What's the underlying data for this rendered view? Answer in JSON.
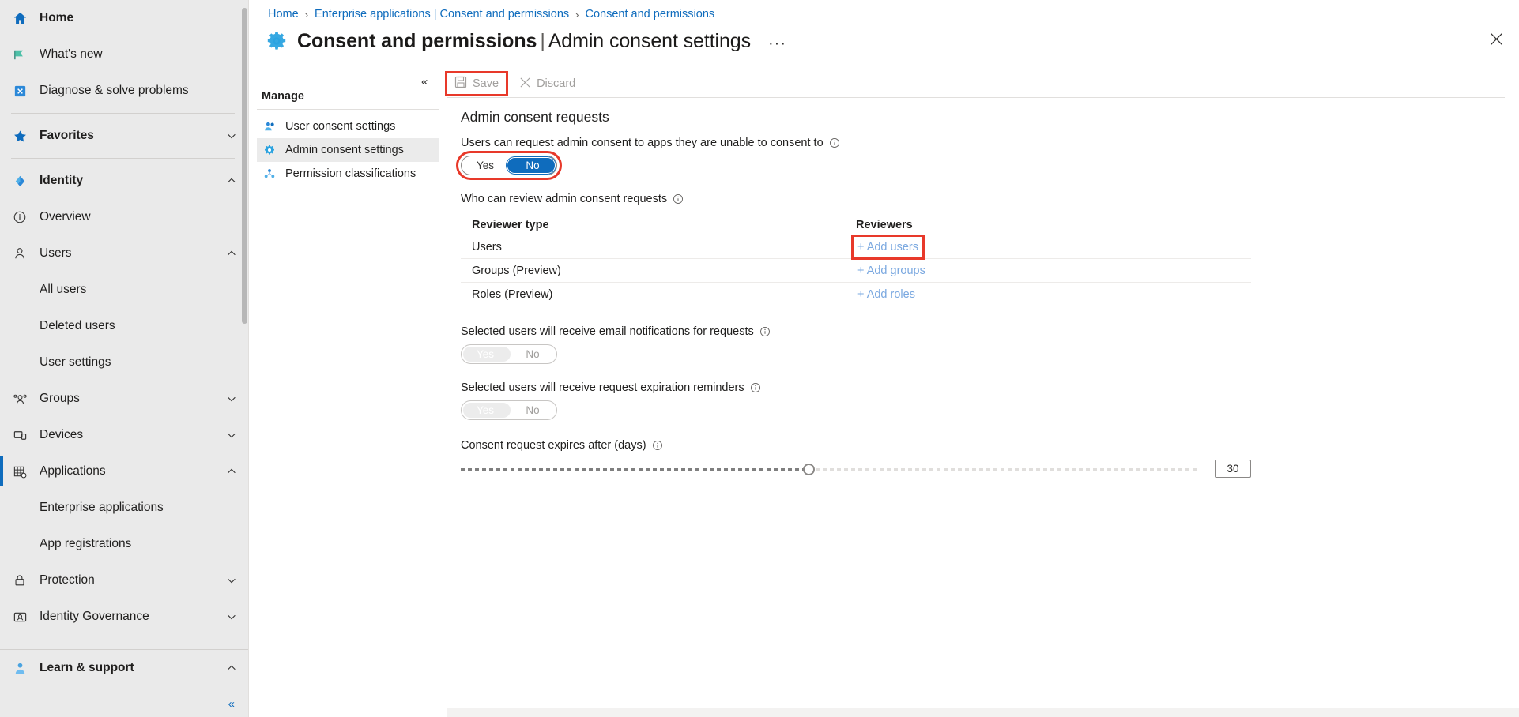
{
  "sidebar": {
    "items": [
      {
        "label": "Home",
        "icon": "home-icon",
        "bold": true,
        "type": "item",
        "chevron": ""
      },
      {
        "label": "What's new",
        "icon": "megaphone-icon",
        "bold": false,
        "type": "item",
        "chevron": ""
      },
      {
        "label": "Diagnose & solve problems",
        "icon": "diagnose-icon",
        "bold": false,
        "type": "item",
        "chevron": ""
      },
      {
        "label": "Favorites",
        "icon": "star-icon",
        "bold": true,
        "type": "item",
        "chevron": "down"
      },
      {
        "label": "Identity",
        "icon": "identity-icon",
        "bold": true,
        "type": "item",
        "chevron": "up"
      },
      {
        "label": "Overview",
        "icon": "info-circle-icon",
        "bold": false,
        "type": "item",
        "chevron": ""
      },
      {
        "label": "Users",
        "icon": "person-icon",
        "bold": false,
        "type": "item",
        "chevron": "up"
      },
      {
        "label": "All users",
        "type": "sub"
      },
      {
        "label": "Deleted users",
        "type": "sub"
      },
      {
        "label": "User settings",
        "type": "sub"
      },
      {
        "label": "Groups",
        "icon": "groups-icon",
        "bold": false,
        "type": "item",
        "chevron": "down"
      },
      {
        "label": "Devices",
        "icon": "devices-icon",
        "bold": false,
        "type": "item",
        "chevron": "down"
      },
      {
        "label": "Applications",
        "icon": "applications-icon",
        "bold": false,
        "type": "item",
        "chevron": "up",
        "active": true
      },
      {
        "label": "Enterprise applications",
        "type": "sub"
      },
      {
        "label": "App registrations",
        "type": "sub"
      },
      {
        "label": "Protection",
        "icon": "lock-icon",
        "bold": false,
        "type": "item",
        "chevron": "down"
      },
      {
        "label": "Identity Governance",
        "icon": "governance-icon",
        "bold": false,
        "type": "item",
        "chevron": "down"
      }
    ],
    "footer": {
      "label": "Learn & support",
      "icon": "support-person-icon",
      "chevron": "up"
    },
    "collapse_label": "«"
  },
  "breadcrumb": {
    "items": [
      "Home",
      "Enterprise applications | Consent and permissions",
      "Consent and permissions"
    ],
    "separator": "›"
  },
  "header": {
    "title_main": "Consent and permissions",
    "title_sep": "|",
    "title_sub": "Admin consent settings",
    "icon": "gear-blue-icon",
    "ellipsis": "···",
    "close_label": "✕"
  },
  "submenu": {
    "heading": "Manage",
    "collapse_label": "«",
    "items": [
      {
        "label": "User consent settings",
        "icon": "user-consent-icon",
        "selected": false
      },
      {
        "label": "Admin consent settings",
        "icon": "admin-consent-gear-icon",
        "selected": true
      },
      {
        "label": "Permission classifications",
        "icon": "permission-class-icon",
        "selected": false
      }
    ]
  },
  "toolbar": {
    "save_label": "Save",
    "save_icon": "save-floppy-icon",
    "save_highlighted": true,
    "discard_label": "Discard",
    "discard_icon": "close-x-icon"
  },
  "content": {
    "section_title": "Admin consent requests",
    "request_consent": {
      "label": "Users can request admin consent to apps they are unable to consent to",
      "info_icon": "info-icon",
      "options": [
        "Yes",
        "No"
      ],
      "selected": "No",
      "highlighted": true
    },
    "reviewers": {
      "label": "Who can review admin consent requests",
      "info_icon": "info-icon",
      "columns": [
        "Reviewer type",
        "Reviewers"
      ],
      "rows": [
        {
          "type": "Users",
          "action": "+ Add users",
          "highlighted": true
        },
        {
          "type": "Groups (Preview)",
          "action": "+ Add groups",
          "highlighted": false
        },
        {
          "type": "Roles (Preview)",
          "action": "+ Add roles",
          "highlighted": false
        }
      ]
    },
    "email_notifications": {
      "label": "Selected users will receive email notifications for requests",
      "info_icon": "info-icon",
      "options": [
        "Yes",
        "No"
      ],
      "selected": "Yes",
      "disabled": true
    },
    "expiration_reminders": {
      "label": "Selected users will receive request expiration reminders",
      "info_icon": "info-icon",
      "options": [
        "Yes",
        "No"
      ],
      "selected": "Yes",
      "disabled": true
    },
    "expires_after": {
      "label": "Consent request expires after (days)",
      "info_icon": "info-icon",
      "value": "30",
      "percent": 47
    }
  },
  "colors": {
    "accent": "#0f6cbd",
    "link": "#0f6cbd",
    "annotation": "#e8392a",
    "sidebar_bg": "#eaeaea",
    "muted": "#a19f9d",
    "soft_link": "#7aa8e0"
  }
}
